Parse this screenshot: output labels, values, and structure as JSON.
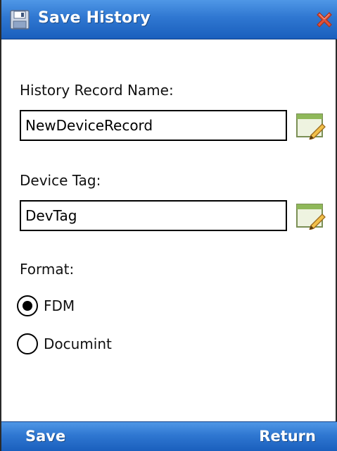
{
  "window": {
    "title": "Save History",
    "title_icon": "floppy-disk-icon",
    "close_icon": "close-x-icon"
  },
  "form": {
    "record_name_label": "History Record Name:",
    "record_name_value": "NewDeviceRecord",
    "device_tag_label": "Device Tag:",
    "device_tag_value": "DevTag",
    "edit_icon": "edit-pencil-icon",
    "format_label": "Format:",
    "format_options": [
      {
        "label": "FDM",
        "selected": true
      },
      {
        "label": "Documint",
        "selected": false
      }
    ]
  },
  "softkeys": {
    "left": "Save",
    "right": "Return"
  },
  "colors": {
    "titlebar": "#2f77d1",
    "background": "#ffffff",
    "close_red": "#d9452b"
  }
}
